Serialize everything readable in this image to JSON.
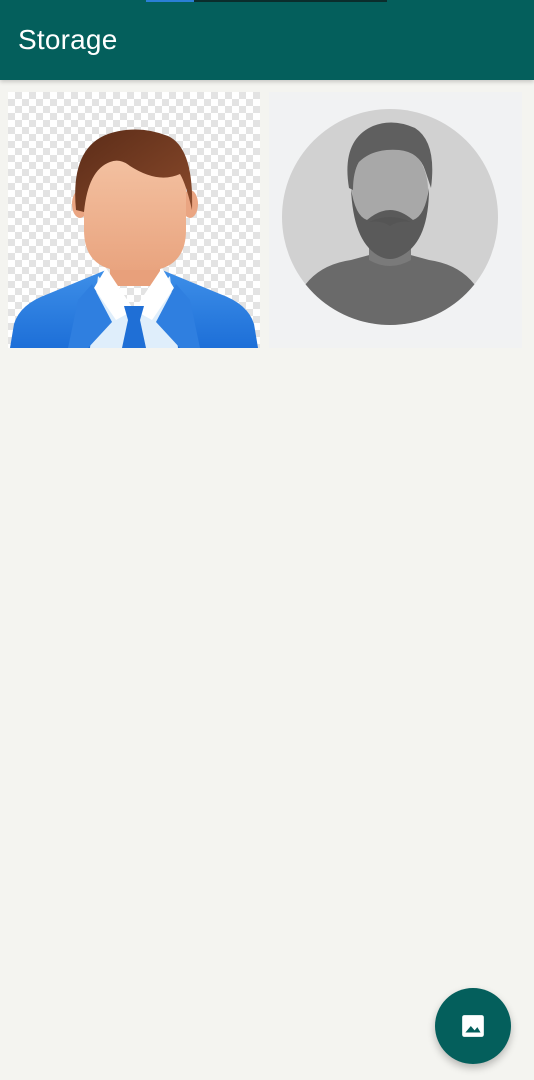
{
  "app_bar": {
    "title": "Storage",
    "color": "#045f5c"
  },
  "images": [
    {
      "name": "businessman-avatar",
      "kind": "illustration"
    },
    {
      "name": "bearded-man-silhouette-avatar",
      "kind": "illustration"
    }
  ],
  "fab": {
    "icon": "image-icon",
    "color": "#045f5c"
  }
}
